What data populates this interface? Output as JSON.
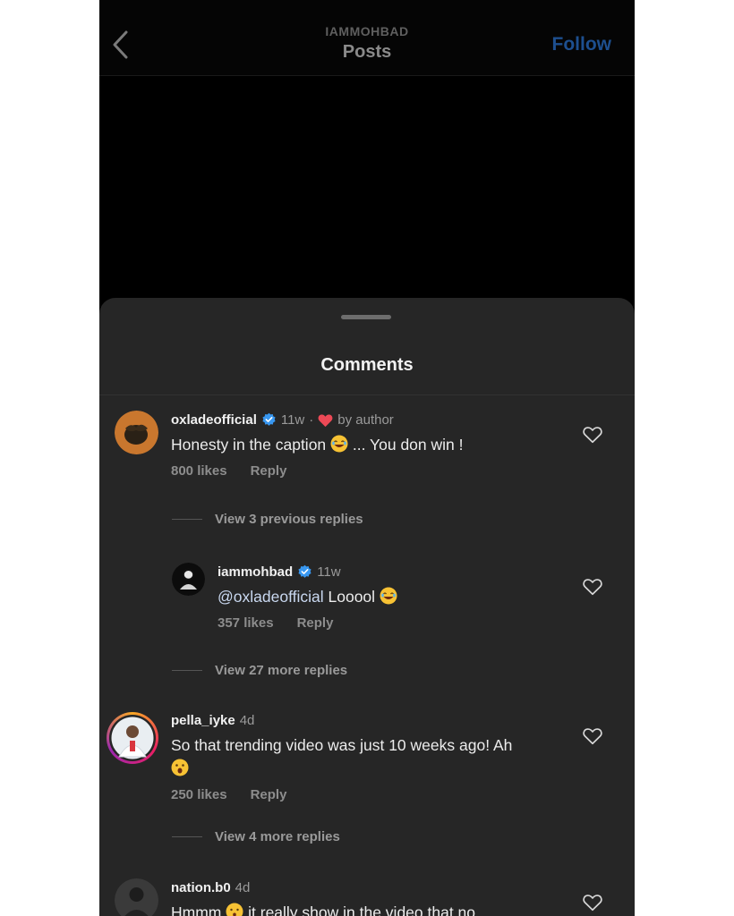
{
  "header": {
    "username": "IAMMOHBAD",
    "title": "Posts",
    "follow_label": "Follow"
  },
  "comments_sheet": {
    "title": "Comments"
  },
  "comments": [
    {
      "username": "oxladeofficial",
      "time": "11w",
      "separator": "·",
      "author_like_label": "by author",
      "text_before": "Honesty in the caption",
      "text_after": "... You don win !",
      "likes": "800 likes",
      "reply_label": "Reply",
      "view_replies": "View 3 previous replies"
    },
    {
      "username": "iammohbad",
      "time": "11w",
      "mention": "@oxladeofficial",
      "text": "Looool",
      "likes": "357 likes",
      "reply_label": "Reply",
      "view_replies": "View 27 more replies"
    },
    {
      "username": "pella_iyke",
      "time": "4d",
      "text": "So that trending video was just 10 weeks ago! Ah",
      "likes": "250 likes",
      "reply_label": "Reply",
      "view_replies": "View 4 more replies"
    },
    {
      "username": "nation.b0",
      "time": "4d",
      "text_before": "Hmmm",
      "text_after": "it really show in the video that no"
    }
  ],
  "colors": {
    "accent": "#1d4f8f",
    "verified": "#3897f0",
    "heart": "#ed4956",
    "sheet_bg": "#262626"
  }
}
